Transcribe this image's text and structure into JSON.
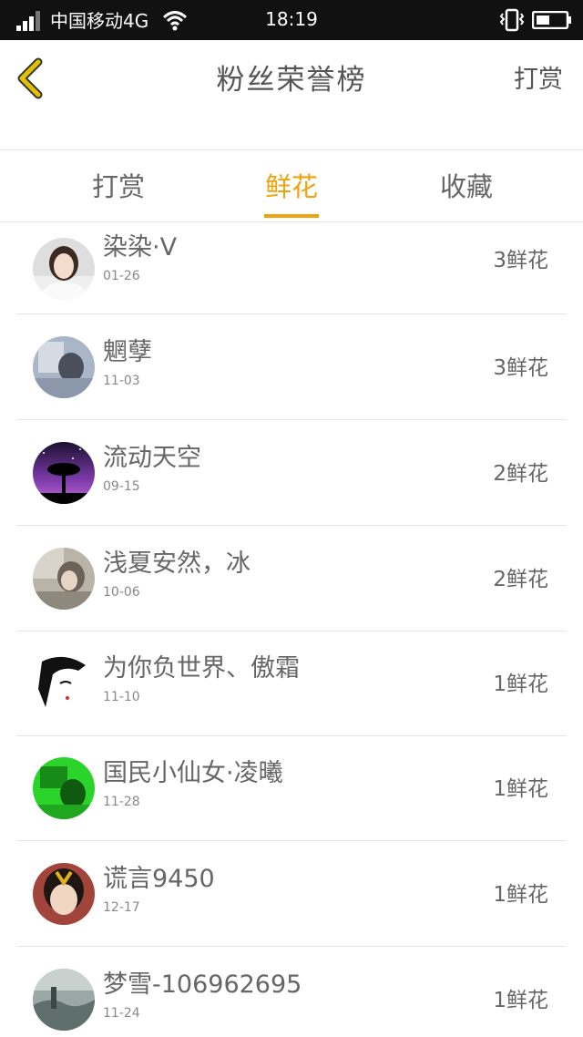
{
  "status_bar": {
    "carrier": "中国移动4G",
    "time": "18:19"
  },
  "header": {
    "title": "粉丝荣誉榜",
    "action": "打赏"
  },
  "tabs": [
    {
      "label": "打赏",
      "active": false
    },
    {
      "label": "鲜花",
      "active": true
    },
    {
      "label": "收藏",
      "active": false
    }
  ],
  "fans": [
    {
      "name": "染染·V",
      "date": "01-26",
      "count": "3鲜花"
    },
    {
      "name": "魍孽",
      "date": "11-03",
      "count": "3鲜花"
    },
    {
      "name": "流动天空",
      "date": "09-15",
      "count": "2鲜花"
    },
    {
      "name": "浅夏安然，冰",
      "date": "10-06",
      "count": "2鲜花"
    },
    {
      "name": "为你负世界、傲霜",
      "date": "11-10",
      "count": "1鲜花"
    },
    {
      "name": "国民小仙女·凌曦",
      "date": "11-28",
      "count": "1鲜花"
    },
    {
      "name": "谎言9450",
      "date": "12-17",
      "count": "1鲜花"
    },
    {
      "name": "梦雪-106962695",
      "date": "11-24",
      "count": "1鲜花"
    }
  ],
  "colors": {
    "accent": "#f0a30f",
    "back_arrow": "#e2c200",
    "status_bar": "#111111"
  }
}
